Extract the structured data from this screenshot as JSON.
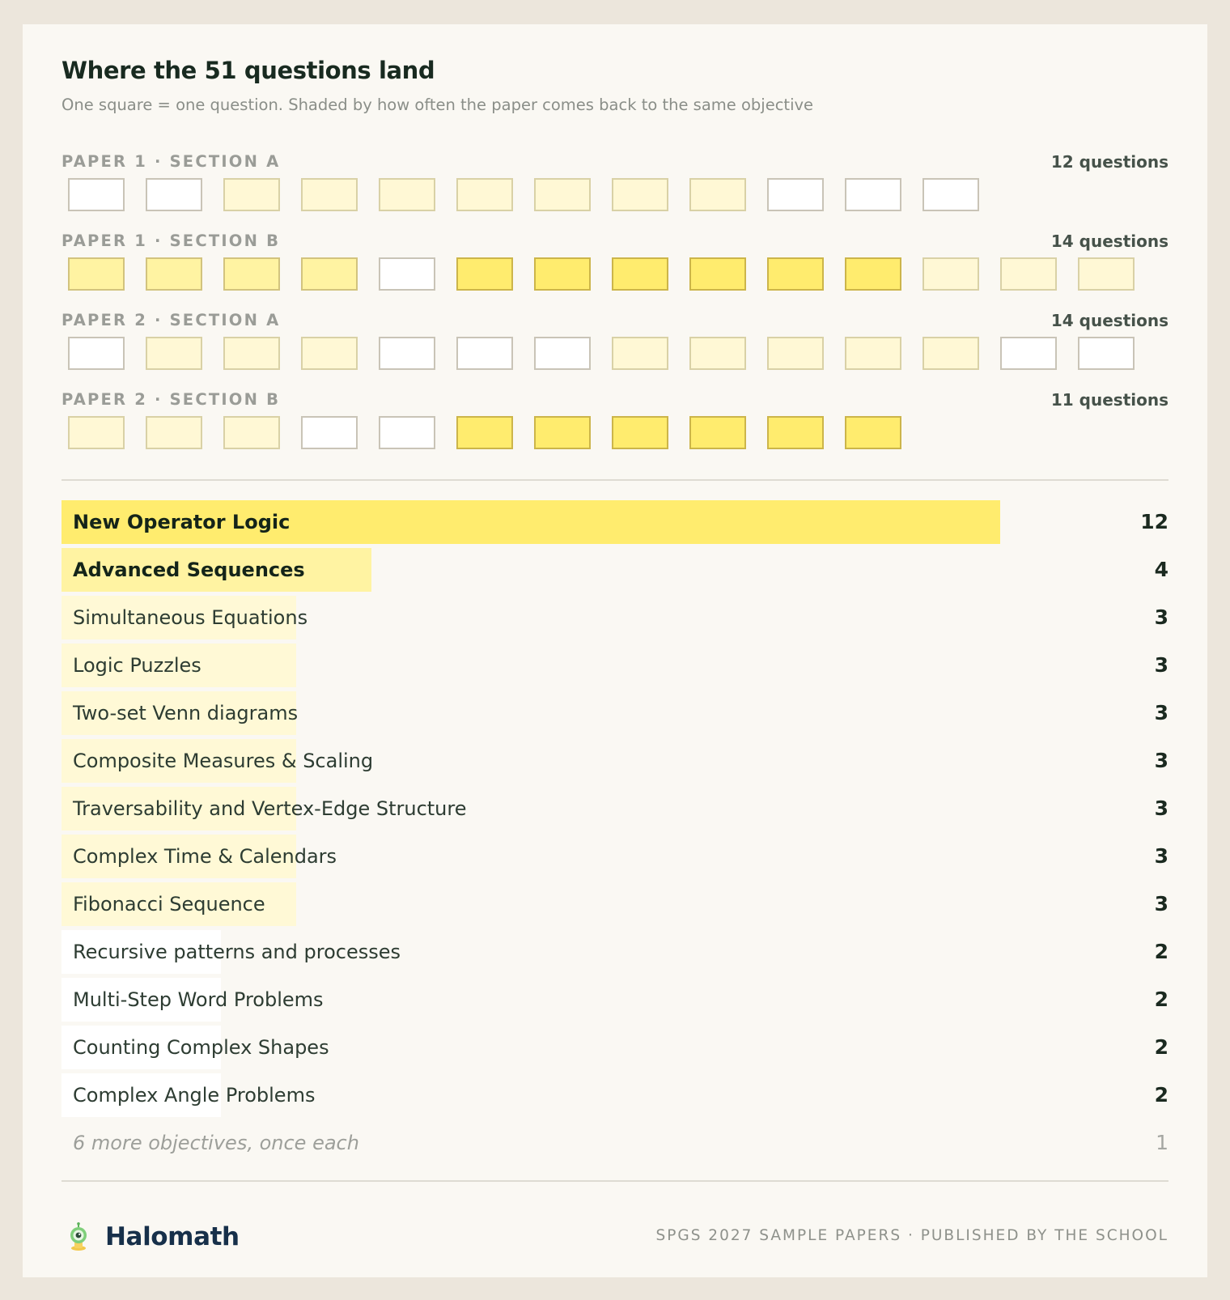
{
  "title": "Where the 51 questions land",
  "subtitle": "One square = one question. Shaded by how often the paper comes back to the same objective",
  "colors": {
    "level_0": "#ffffff",
    "level_1": "#fff8d5",
    "level_2": "#fff3a2",
    "level_3": "#ffec6e",
    "background": "#ece6dc",
    "card": "#faf8f3"
  },
  "chart_data": [
    {
      "type": "heatmap",
      "title": "Where the 51 questions land",
      "description_note": "One square = one question. Shaded by how often the paper comes back to the same objective",
      "sections": [
        {
          "name": "PAPER 1 · SECTION A",
          "count_label": "12 questions",
          "levels": [
            0,
            0,
            1,
            1,
            1,
            1,
            1,
            1,
            1,
            0,
            0,
            0
          ]
        },
        {
          "name": "PAPER 1 · SECTION B",
          "count_label": "14 questions",
          "levels": [
            2,
            2,
            2,
            2,
            0,
            3,
            3,
            3,
            3,
            3,
            3,
            1,
            1,
            1
          ]
        },
        {
          "name": "PAPER 2 · SECTION A",
          "count_label": "14 questions",
          "levels": [
            0,
            1,
            1,
            1,
            0,
            0,
            0,
            1,
            1,
            1,
            1,
            1,
            0,
            0
          ]
        },
        {
          "name": "PAPER 2 · SECTION B",
          "count_label": "11 questions",
          "levels": [
            1,
            1,
            1,
            0,
            0,
            3,
            3,
            3,
            3,
            3,
            3
          ]
        }
      ]
    },
    {
      "type": "bar",
      "orientation": "horizontal",
      "xlim": [
        0,
        12
      ],
      "categories": [
        "New Operator Logic",
        "Advanced Sequences",
        "Simultaneous Equations",
        "Logic Puzzles",
        "Two-set Venn diagrams",
        "Composite Measures & Scaling",
        "Traversability and Vertex-Edge Structure",
        "Complex Time & Calendars",
        "Fibonacci Sequence",
        "Recursive patterns and processes",
        "Multi-Step Word Problems",
        "Counting Complex Shapes",
        "Complex Angle Problems",
        "6 more objectives, once each"
      ],
      "values": [
        12,
        4,
        3,
        3,
        3,
        3,
        3,
        3,
        3,
        2,
        2,
        2,
        2,
        1
      ],
      "value_labels": [
        "12",
        "4",
        "3",
        "3",
        "3",
        "3",
        "3",
        "3",
        "3",
        "2",
        "2",
        "2",
        "2",
        "1"
      ],
      "levels": [
        3,
        2,
        1,
        1,
        1,
        1,
        1,
        1,
        1,
        0,
        0,
        0,
        0,
        0
      ],
      "emphasis": [
        "strong",
        "strong",
        "normal",
        "normal",
        "normal",
        "normal",
        "normal",
        "normal",
        "normal",
        "normal",
        "normal",
        "normal",
        "normal",
        "muted"
      ]
    }
  ],
  "footer": {
    "brand": "Halomath",
    "brand_icon": "robot-mascot-icon",
    "note": "SPGS 2027 SAMPLE PAPERS · PUBLISHED BY THE SCHOOL"
  }
}
